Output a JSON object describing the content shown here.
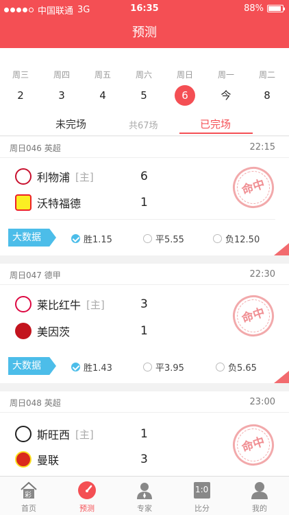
{
  "status": {
    "carrier": "中国联通",
    "network": "3G",
    "time": "16:35",
    "battery": "88%",
    "battery_level": 0.88
  },
  "nav": {
    "title": "预测"
  },
  "days": [
    {
      "week": "周三",
      "num": "2"
    },
    {
      "week": "周四",
      "num": "3"
    },
    {
      "week": "周五",
      "num": "4"
    },
    {
      "week": "周六",
      "num": "5"
    },
    {
      "week": "周日",
      "num": "6",
      "active": true
    },
    {
      "week": "周一",
      "num": "今"
    },
    {
      "week": "周二",
      "num": "8"
    }
  ],
  "tabs": {
    "unfinished": "未完场",
    "total": "共67场",
    "finished": "已完场"
  },
  "stamp_text": "命中",
  "bigdata_label": "大数据",
  "matches": [
    {
      "header": "周日046 英超",
      "time": "22:15",
      "home_team": "利物浦",
      "home_tag": "[主]",
      "home_score": "6",
      "away_team": "沃特福德",
      "away_score": "1",
      "odds": {
        "win": "胜1.15",
        "draw": "平5.55",
        "lose": "负12.50"
      }
    },
    {
      "header": "周日047 德甲",
      "time": "22:30",
      "home_team": "莱比红牛",
      "home_tag": "[主]",
      "home_score": "3",
      "away_team": "美因茨",
      "away_score": "1",
      "odds": {
        "win": "胜1.43",
        "draw": "平3.95",
        "lose": "负5.65"
      }
    },
    {
      "header": "周日048 英超",
      "time": "23:00",
      "home_team": "斯旺西",
      "home_tag": "[主]",
      "home_score": "1",
      "away_team": "曼联",
      "away_score": "3"
    }
  ],
  "tabbar": {
    "home": "首页",
    "home_icon_char": "彩",
    "predict": "预测",
    "expert": "专家",
    "score": "比分",
    "score_icon_char": "1:0",
    "mine": "我的"
  },
  "colors": {
    "primary": "#f44f54",
    "accent": "#4cbde9"
  }
}
